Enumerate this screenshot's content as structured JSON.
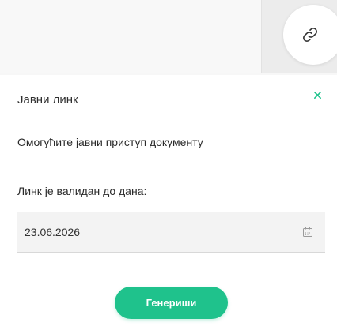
{
  "popup": {
    "title": "Јавни линк",
    "description": "Омогућите јавни приступ документу",
    "date_label": "Линк је валидан до дана:",
    "date_value": "23.06.2026",
    "generate_label": "Генериши"
  },
  "icons": {
    "link": "link-icon",
    "close": "close-icon",
    "calendar": "calendar-icon"
  },
  "colors": {
    "accent": "#1fc28c",
    "link_icon": "#333333",
    "close_icon": "#1fc28c"
  }
}
